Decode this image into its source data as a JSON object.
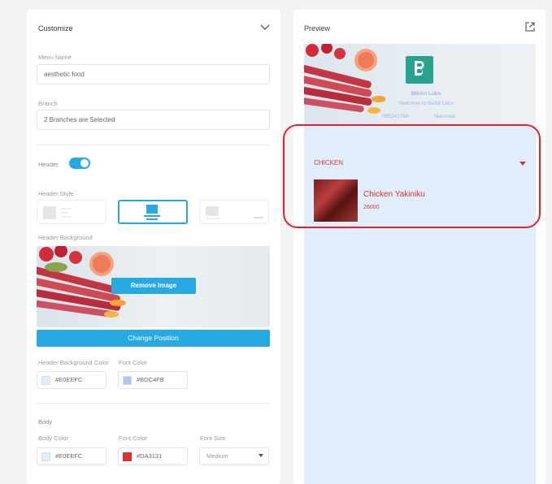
{
  "customize": {
    "title": "Customize",
    "menu_name_label": "Menu Name",
    "menu_name_value": "aesthetic food",
    "branch_label": "Branch",
    "branch_value": "2 Branches are Selected",
    "header_label": "Header",
    "header_toggle_on": true,
    "header_style_label": "Header Style",
    "header_background_label": "Header Background",
    "remove_image_button": "Remove Image",
    "change_position_button": "Change Position",
    "header_bg_color_label": "Header Background Color",
    "header_bg_color_value": "#E0EEFC",
    "header_font_color_label": "Font Color",
    "header_font_color_value": "#BDC4FB",
    "body_label": "Body",
    "body_color_label": "Body Color",
    "body_color_value": "#E0EEFC",
    "body_font_color_label": "Font Color",
    "body_font_color_value": "#DA3131",
    "font_size_label": "Font Size",
    "font_size_value": "Medium"
  },
  "preview": {
    "title": "Preview",
    "brand": "BlkArt Labs",
    "welcome": "Welcome to Belkit Labs",
    "contact": "085241768",
    "contact_extra": "Mainstan",
    "category": "CHICKEN",
    "item_name": "Chicken Yakiniku",
    "item_price": "26000"
  },
  "colors": {
    "accent": "#27a9e1",
    "preview_bg": "#e0eefc",
    "header_font": "#bdc4fb",
    "body_font": "#da3131"
  },
  "icons": [
    "chevron-down-icon",
    "external-link-icon",
    "caret-down-icon"
  ]
}
